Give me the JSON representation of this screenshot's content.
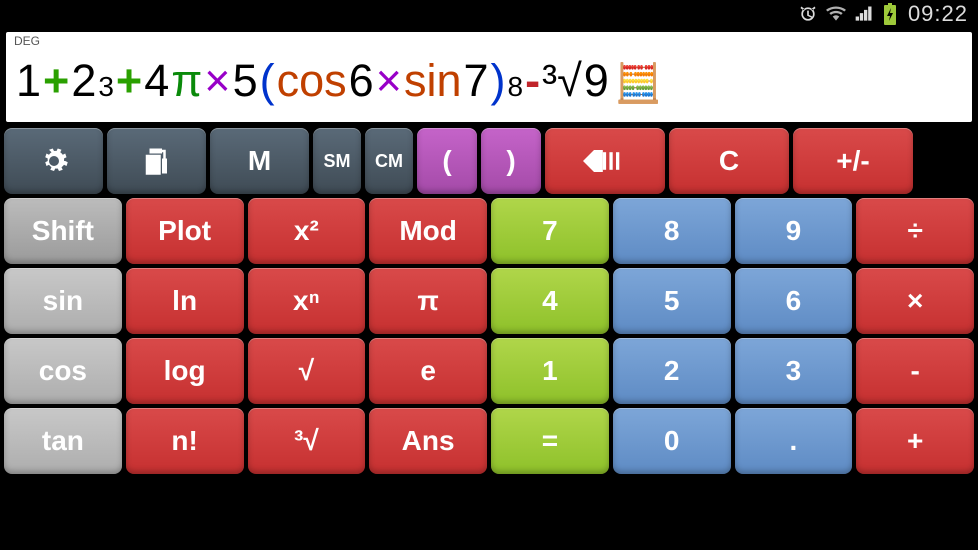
{
  "status": {
    "time": "09:22"
  },
  "display": {
    "mode": "DEG",
    "expression_tokens": [
      {
        "text": "1",
        "cls": "tok-num"
      },
      {
        "text": " + ",
        "cls": "tok-plus"
      },
      {
        "text": "2",
        "cls": "tok-num"
      },
      {
        "text": "3",
        "cls": "tok-num",
        "sup": true
      },
      {
        "text": " + ",
        "cls": "tok-plus"
      },
      {
        "text": "4",
        "cls": "tok-num"
      },
      {
        "text": "π",
        "cls": "tok-pi"
      },
      {
        "text": " × ",
        "cls": "tok-mul"
      },
      {
        "text": "5",
        "cls": "tok-num"
      },
      {
        "text": "(",
        "cls": "tok-paren"
      },
      {
        "text": "cos ",
        "cls": "tok-trig"
      },
      {
        "text": "6",
        "cls": "tok-num"
      },
      {
        "text": " × ",
        "cls": "tok-mul"
      },
      {
        "text": "sin ",
        "cls": "tok-trig"
      },
      {
        "text": "7",
        "cls": "tok-num"
      },
      {
        "text": ")",
        "cls": "tok-paren"
      },
      {
        "text": "8",
        "cls": "tok-num",
        "sup": true
      },
      {
        "text": " - ",
        "cls": "tok-minus"
      },
      {
        "text": "³√",
        "cls": "tok-root"
      },
      {
        "text": "9",
        "cls": "tok-num"
      }
    ]
  },
  "top_row": [
    {
      "name": "settings-button",
      "icon": "gear",
      "cls": "btn-dark"
    },
    {
      "name": "copy-button",
      "icon": "copy",
      "cls": "btn-dark"
    },
    {
      "name": "memory-button",
      "label": "M",
      "cls": "btn-dark"
    },
    {
      "name": "sm-button",
      "label": "SM",
      "cls": "btn-dark btn-small"
    },
    {
      "name": "cm-button",
      "label": "CM",
      "cls": "btn-dark btn-small"
    },
    {
      "name": "open-paren-button",
      "label": "(",
      "cls": "btn-purple"
    },
    {
      "name": "close-paren-button",
      "label": ")",
      "cls": "btn-purple"
    },
    {
      "name": "backspace-button",
      "icon": "backspace",
      "cls": "btn-red"
    },
    {
      "name": "clear-button",
      "label": "C",
      "cls": "btn-red"
    },
    {
      "name": "sign-button",
      "label": "+/-",
      "cls": "btn-red"
    }
  ],
  "main_grid": [
    {
      "name": "shift-button",
      "label": "Shift",
      "cls": "btn-grey"
    },
    {
      "name": "plot-button",
      "label": "Plot",
      "cls": "btn-red"
    },
    {
      "name": "square-button",
      "label": "x²",
      "cls": "btn-red"
    },
    {
      "name": "mod-button",
      "label": "Mod",
      "cls": "btn-red"
    },
    {
      "name": "digit-7-button",
      "label": "7",
      "cls": "btn-green"
    },
    {
      "name": "digit-8-button",
      "label": "8",
      "cls": "btn-blue"
    },
    {
      "name": "digit-9-button",
      "label": "9",
      "cls": "btn-blue"
    },
    {
      "name": "divide-button",
      "label": "÷",
      "cls": "btn-red"
    },
    {
      "name": "sin-button",
      "label": "sin",
      "cls": "btn-lightgrey"
    },
    {
      "name": "ln-button",
      "label": "ln",
      "cls": "btn-red"
    },
    {
      "name": "power-button",
      "label": "xⁿ",
      "cls": "btn-red"
    },
    {
      "name": "pi-button",
      "label": "π",
      "cls": "btn-red"
    },
    {
      "name": "digit-4-button",
      "label": "4",
      "cls": "btn-green"
    },
    {
      "name": "digit-5-button",
      "label": "5",
      "cls": "btn-blue"
    },
    {
      "name": "digit-6-button",
      "label": "6",
      "cls": "btn-blue"
    },
    {
      "name": "multiply-button",
      "label": "×",
      "cls": "btn-red"
    },
    {
      "name": "cos-button",
      "label": "cos",
      "cls": "btn-lightgrey"
    },
    {
      "name": "log-button",
      "label": "log",
      "cls": "btn-red"
    },
    {
      "name": "sqrt-button",
      "label": "√",
      "cls": "btn-red"
    },
    {
      "name": "e-button",
      "label": "e",
      "cls": "btn-red"
    },
    {
      "name": "digit-1-button",
      "label": "1",
      "cls": "btn-green"
    },
    {
      "name": "digit-2-button",
      "label": "2",
      "cls": "btn-blue"
    },
    {
      "name": "digit-3-button",
      "label": "3",
      "cls": "btn-blue"
    },
    {
      "name": "subtract-button",
      "label": "-",
      "cls": "btn-red"
    },
    {
      "name": "tan-button",
      "label": "tan",
      "cls": "btn-lightgrey"
    },
    {
      "name": "factorial-button",
      "label": "n!",
      "cls": "btn-red"
    },
    {
      "name": "cuberoot-button",
      "label": "³√",
      "cls": "btn-red"
    },
    {
      "name": "ans-button",
      "label": "Ans",
      "cls": "btn-red"
    },
    {
      "name": "equals-button",
      "label": "=",
      "cls": "btn-green"
    },
    {
      "name": "digit-0-button",
      "label": "0",
      "cls": "btn-blue"
    },
    {
      "name": "decimal-button",
      "label": ".",
      "cls": "btn-blue"
    },
    {
      "name": "add-button",
      "label": "+",
      "cls": "btn-red"
    }
  ]
}
